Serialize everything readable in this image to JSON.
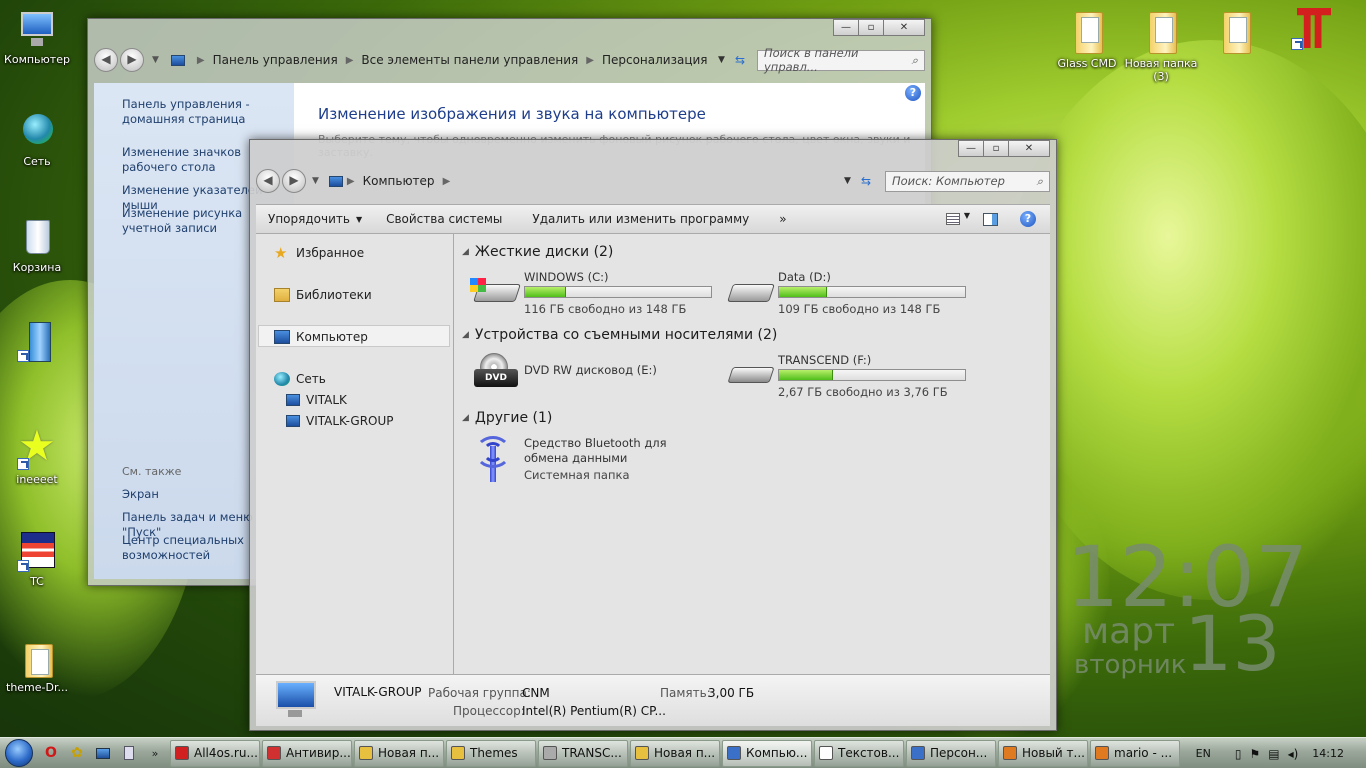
{
  "desktop": {
    "icons_left": [
      {
        "label": "Компьютер"
      },
      {
        "label": "Сеть"
      },
      {
        "label": "Корзина"
      },
      {
        "label": ""
      },
      {
        "label": "ineeeet"
      },
      {
        "label": "TC"
      },
      {
        "label": "theme-Dr..."
      }
    ],
    "icons_top": [
      {
        "label": "Glass CMD"
      },
      {
        "label": "Новая папка (3)"
      },
      {
        "label": ""
      },
      {
        "label": ""
      }
    ]
  },
  "clock": {
    "time": "12:07",
    "month": "март",
    "day": "13",
    "weekday": "вторник"
  },
  "personalization_window": {
    "breadcrumb": [
      "Панель управления",
      "Все элементы панели управления",
      "Персонализация"
    ],
    "search_placeholder": "Поиск в панели управл...",
    "left_links": [
      "Панель управления - домашняя страница",
      "Изменение значков рабочего стола",
      "Изменение указателей мыши",
      "Изменение рисунка учетной записи"
    ],
    "see_also": "См. также",
    "see_also_links": [
      "Экран",
      "Панель задач и меню \"Пуск\"",
      "Центр специальных возможностей"
    ],
    "title": "Изменение изображения и звука на компьютере",
    "subtitle": "Выберите тему, чтобы одновременно изменить фоновый рисунок рабочего стола, цвет окна, звуки и заставку."
  },
  "computer_window": {
    "breadcrumb": [
      "Компьютер"
    ],
    "search_placeholder": "Поиск: Компьютер",
    "toolbar": {
      "organize": "Упорядочить",
      "system_properties": "Свойства системы",
      "uninstall": "Удалить или изменить программу",
      "more": "»"
    },
    "nav": {
      "favorites": "Избранное",
      "libraries": "Библиотеки",
      "computer": "Компьютер",
      "network": "Сеть",
      "network_items": [
        "VITALK",
        "VITALK-GROUP"
      ]
    },
    "groups": {
      "hard_disks": "Жесткие диски (2)",
      "removable": "Устройства со съемными носителями (2)",
      "other": "Другие (1)"
    },
    "drives": [
      {
        "name": "WINDOWS (C:)",
        "free": "116 ГБ свободно из 148 ГБ",
        "used_fraction": 0.22
      },
      {
        "name": "Data (D:)",
        "free": "109 ГБ свободно из 148 ГБ",
        "used_fraction": 0.26
      },
      {
        "name": "DVD RW дисковод (E:)",
        "free": ""
      },
      {
        "name": "TRANSCEND (F:)",
        "free": "2,67 ГБ свободно из 3,76 ГБ",
        "used_fraction": 0.29
      }
    ],
    "bluetooth": {
      "name": "Средство Bluetooth для обмена данными",
      "type": "Системная папка"
    },
    "details": {
      "name": "VITALK-GROUP",
      "workgroup_label": "Рабочая группа:",
      "workgroup_value": "CNM",
      "memory_label": "Память:",
      "memory_value": "3,00 ГБ",
      "cpu_label": "Процессор:",
      "cpu_value": "Intel(R) Pentium(R) CP..."
    }
  },
  "taskbar": {
    "tasks": [
      "All4os.ru...",
      "Антивир...",
      "Новая п...",
      "Themes",
      "TRANSC...",
      "Новая п...",
      "Компью...",
      "Текстов...",
      "Персон...",
      "Новый т...",
      "mario - ..."
    ],
    "task_colors": [
      "#d02020",
      "#d03030",
      "#e8c040",
      "#e8c040",
      "#aaaaaa",
      "#e8c040",
      "#3a70c8",
      "#ffffff",
      "#3a70c8",
      "#e07a20",
      "#e07a20"
    ],
    "lang": "EN",
    "time": "14:12"
  }
}
